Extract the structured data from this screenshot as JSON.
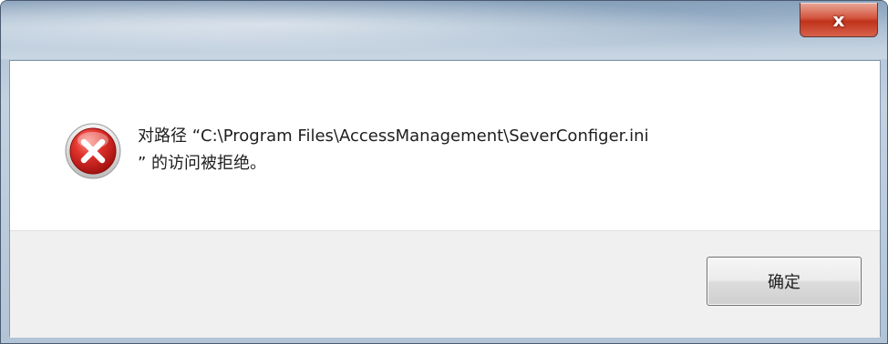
{
  "titlebar": {
    "close_label": "x"
  },
  "dialog": {
    "icon": "error-icon",
    "message_line1": "对路径 “C:\\Program Files\\AccessManagement\\SeverConfiger.ini",
    "message_line2": "” 的访问被拒绝。"
  },
  "buttons": {
    "ok_label": "确定"
  },
  "colors": {
    "error_red": "#d9262b",
    "close_red": "#c0321b",
    "footer_bg": "#f0f0f0"
  }
}
